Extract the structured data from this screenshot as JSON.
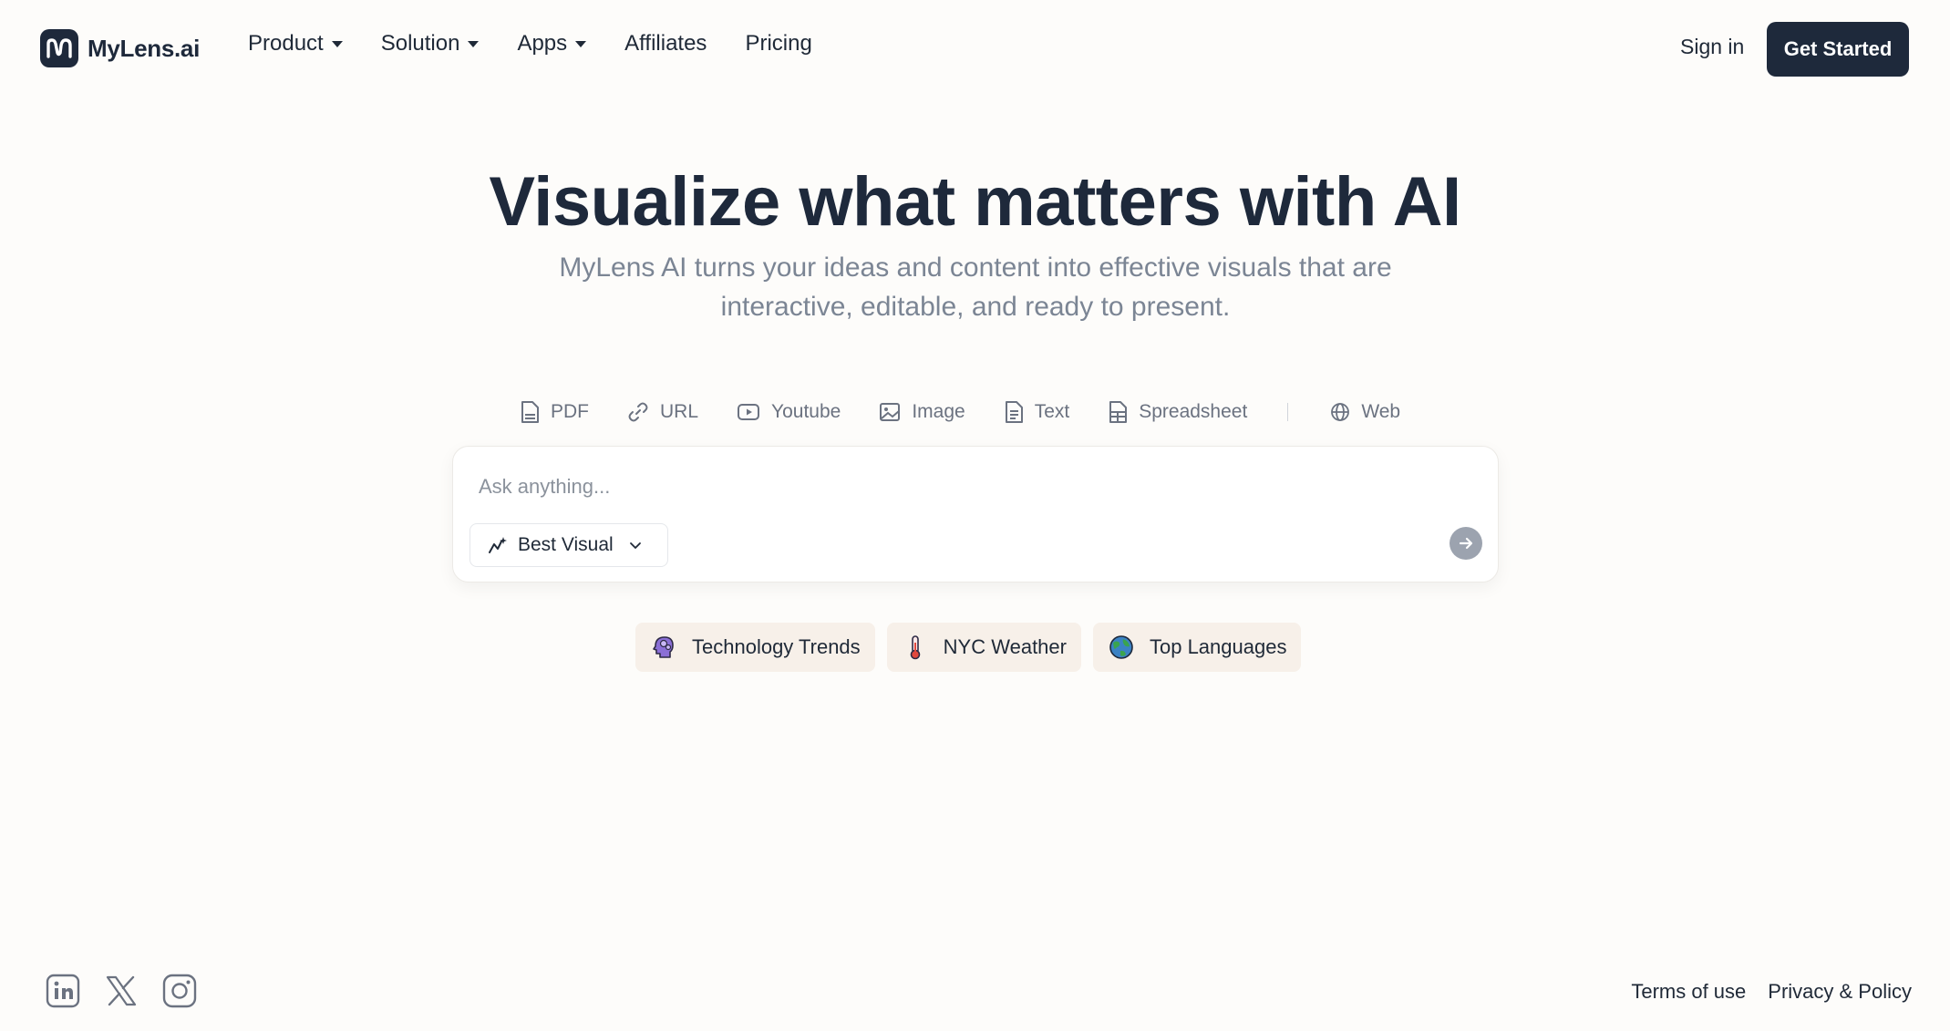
{
  "header": {
    "logo_text": "MyLens.ai",
    "nav": [
      {
        "label": "Product",
        "has_dropdown": true
      },
      {
        "label": "Solution",
        "has_dropdown": true
      },
      {
        "label": "Apps",
        "has_dropdown": true
      },
      {
        "label": "Affiliates",
        "has_dropdown": false
      },
      {
        "label": "Pricing",
        "has_dropdown": false
      }
    ],
    "sign_in": "Sign in",
    "cta": "Get Started"
  },
  "hero": {
    "title": "Visualize what matters with AI",
    "subtitle": "MyLens AI turns your ideas and content into effective visuals that are interactive, editable, and ready to present."
  },
  "sources": [
    {
      "label": "PDF",
      "icon": "pdf-file-icon"
    },
    {
      "label": "URL",
      "icon": "link-icon"
    },
    {
      "label": "Youtube",
      "icon": "youtube-icon"
    },
    {
      "label": "Image",
      "icon": "image-icon"
    },
    {
      "label": "Text",
      "icon": "text-file-icon"
    },
    {
      "label": "Spreadsheet",
      "icon": "spreadsheet-icon"
    },
    {
      "label": "Web",
      "icon": "globe-icon"
    }
  ],
  "ask": {
    "placeholder": "Ask anything...",
    "mode_label": "Best Visual",
    "mode_icon": "sparkle-chart-icon",
    "send_icon": "arrow-right-icon"
  },
  "suggestions": [
    {
      "label": "Technology Trends",
      "icon": "brain-head-icon"
    },
    {
      "label": "NYC Weather",
      "icon": "thermometer-icon"
    },
    {
      "label": "Top Languages",
      "icon": "globe-earth-icon"
    }
  ],
  "footer": {
    "socials": [
      "linkedin-icon",
      "x-icon",
      "instagram-icon"
    ],
    "terms": "Terms of use",
    "privacy": "Privacy & Policy"
  },
  "colors": {
    "background": "#fdfcfa",
    "primary_dark": "#1e293b",
    "muted_text": "#7b8594",
    "chip_bg": "#f7f0e9"
  }
}
